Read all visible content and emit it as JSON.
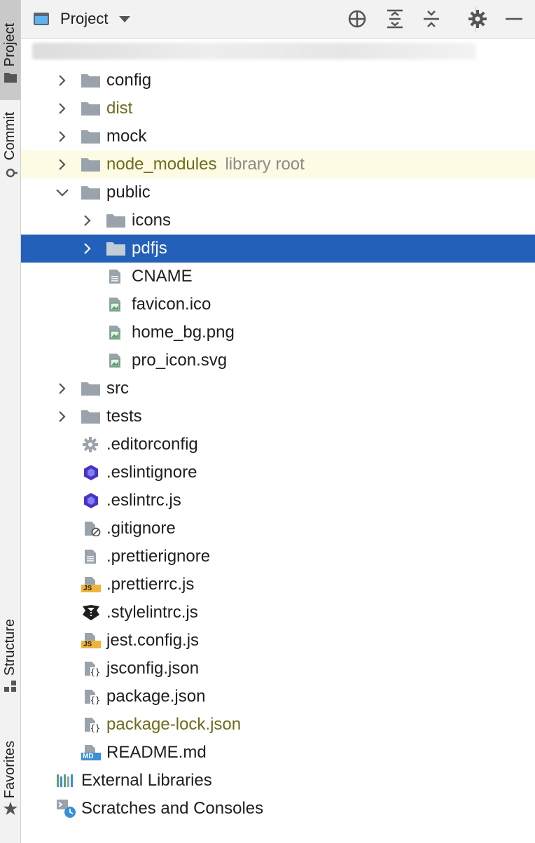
{
  "left_strip": {
    "tabs": [
      {
        "label": "Project"
      },
      {
        "label": "Commit"
      },
      {
        "label": "Structure"
      },
      {
        "label": "Favorites"
      }
    ]
  },
  "header": {
    "title": "Project"
  },
  "tree": {
    "items": [
      {
        "label": "config"
      },
      {
        "label": "dist"
      },
      {
        "label": "mock"
      },
      {
        "label": "node_modules",
        "secondary": "library root"
      },
      {
        "label": "public"
      },
      {
        "label": "icons"
      },
      {
        "label": "pdfjs"
      },
      {
        "label": "CNAME"
      },
      {
        "label": "favicon.ico"
      },
      {
        "label": "home_bg.png"
      },
      {
        "label": "pro_icon.svg"
      },
      {
        "label": "src"
      },
      {
        "label": "tests"
      },
      {
        "label": ".editorconfig"
      },
      {
        "label": ".eslintignore"
      },
      {
        "label": ".eslintrc.js"
      },
      {
        "label": ".gitignore"
      },
      {
        "label": ".prettierignore"
      },
      {
        "label": ".prettierrc.js"
      },
      {
        "label": ".stylelintrc.js"
      },
      {
        "label": "jest.config.js"
      },
      {
        "label": "jsconfig.json"
      },
      {
        "label": "package.json"
      },
      {
        "label": "package-lock.json"
      },
      {
        "label": "README.md"
      },
      {
        "label": "External Libraries"
      },
      {
        "label": "Scratches and Consoles"
      }
    ]
  },
  "badges": {
    "js": "JS",
    "md": "MD"
  },
  "colors": {
    "selection": "#2360b9",
    "highlight_row": "#fdfbe3",
    "excluded_text": "#6e6b1e",
    "folder": "#9aa3ab",
    "eslint": "#4b32c3",
    "js_badge": "#f0b43c",
    "md_badge": "#3a8fd6"
  }
}
